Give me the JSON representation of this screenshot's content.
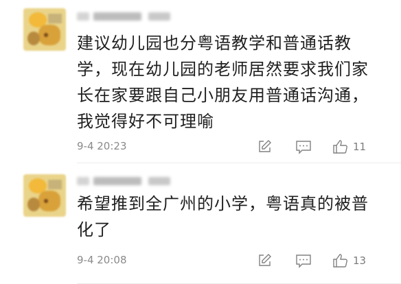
{
  "comments": [
    {
      "content": "建议幼儿园也分粤语教学和普通话教学，现在幼儿园的老师居然要求我们家长在家要跟自己小朋友用普通话沟通，我觉得好不可理喻",
      "time": "9-4 20:23",
      "likes": "11"
    },
    {
      "content": "希望推到全广州的小学，粤语真的被普化了",
      "time": "9-4 20:08",
      "likes": "13"
    }
  ],
  "icons": {
    "edit": "edit-icon",
    "reply": "comment-reply-icon",
    "like": "thumbs-up-icon"
  },
  "colors": {
    "text": "#1f1f1f",
    "meta": "#8a8a8a",
    "icon": "#808080",
    "divider": "#ececec"
  }
}
